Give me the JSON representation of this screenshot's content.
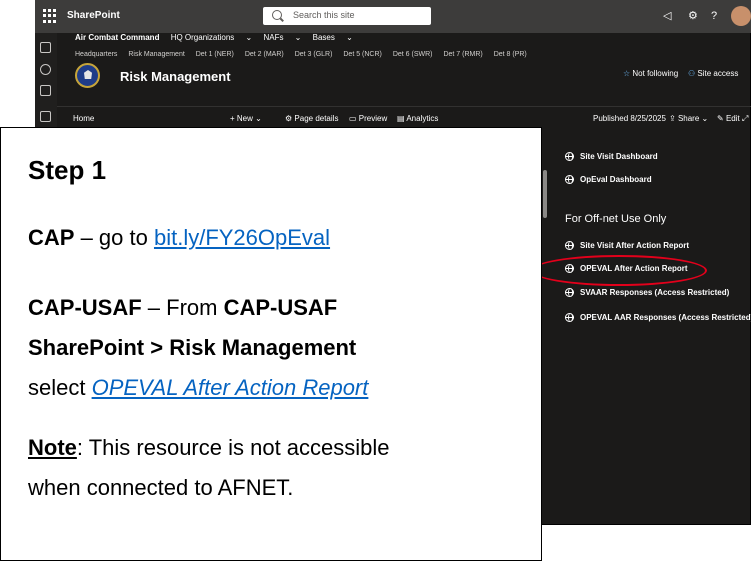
{
  "suite_bar": {
    "app_title": "SharePoint",
    "search_placeholder": "Search this site",
    "icons": [
      "app-launcher-icon",
      "megaphone-icon",
      "gear-icon",
      "help-icon",
      "avatar"
    ],
    "background": "#3d3c3b",
    "help_label": "?"
  },
  "hub_nav": {
    "title": "Air Combat Command",
    "items": [
      "HQ Organizations",
      "NAFs",
      "Bases"
    ]
  },
  "site_nav": {
    "items": [
      "Headquarters",
      "Risk Management",
      "Det 1 (NER)",
      "Det 2 (MAR)",
      "Det 3 (GLR)",
      "Det 5 (NCR)",
      "Det 6 (SWR)",
      "Det 7 (RMR)",
      "Det 8 (PR)"
    ]
  },
  "site_header": {
    "title": "Risk Management",
    "follow_label": "Not following",
    "access_label": "Site access"
  },
  "command_bar": {
    "home": "Home",
    "new": "New",
    "page_details": "Page details",
    "preview": "Preview",
    "analytics": "Analytics",
    "published": "Published 8/25/2025",
    "share": "Share",
    "edit": "Edit"
  },
  "quick_links": {
    "top": [
      "Site Visit Dashboard",
      "OpEval Dashboard"
    ],
    "offnet_heading": "For Off-net Use Only",
    "offnet": [
      "Site Visit After Action Report",
      "OPEVAL After Action Report",
      "SVAAR Responses (Access Restricted)",
      "OPEVAL AAR Responses (Access Restricted)"
    ],
    "highlighted": "OPEVAL After Action Report",
    "highlight_color": "#e3001b"
  },
  "callout": {
    "title": "Step 1",
    "cap_label": "CAP",
    "cap_text": " – go to ",
    "cap_link": "bit.ly/FY26OpEval",
    "usaf_label": "CAP-USAF",
    "usaf_text": " – From ",
    "usaf_bold1": "CAP-USAF",
    "usaf_bold2": "SharePoint > Risk Management",
    "select_text": "select ",
    "select_link": "OPEVAL After Action Report",
    "note_label": "Note",
    "note_text1": ": This resource is not accessible",
    "note_text2": "when connected to AFNET.",
    "link_color": "#0563c1"
  }
}
